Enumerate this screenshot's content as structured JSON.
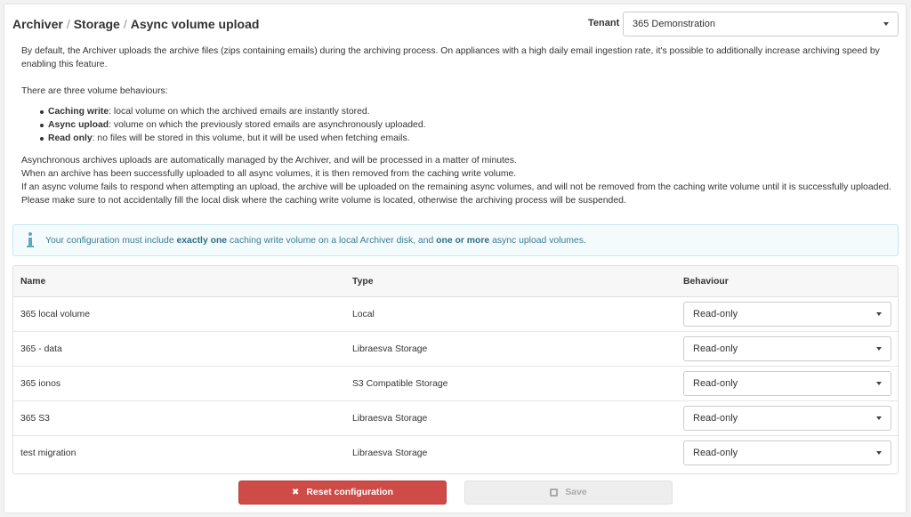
{
  "header": {
    "breadcrumb": [
      "Archiver",
      "Storage",
      "Async volume upload"
    ],
    "tenant_label": "Tenant",
    "tenant_value": "365 Demonstration"
  },
  "intro": {
    "p1": "By default, the Archiver uploads the archive files (zips containing emails) during the archiving process. On appliances with a high daily email ingestion rate, it's possible to additionally increase archiving speed by enabling this feature.",
    "p2": "There are three volume behaviours:",
    "bullets": [
      {
        "term": "Caching write",
        "desc": ": local volume on which the archived emails are instantly stored."
      },
      {
        "term": "Async upload",
        "desc": ": volume on which the previously stored emails are asynchronously uploaded."
      },
      {
        "term": "Read only",
        "desc": ": no files will be stored in this volume, but it will be used when fetching emails."
      }
    ],
    "lines": [
      "Asynchronous archives uploads are automatically managed by the Archiver, and will be processed in a matter of minutes.",
      "When an archive has been successfully uploaded to all async volumes, it is then removed from the caching write volume.",
      "If an async volume fails to respond when attempting an upload, the archive will be uploaded on the remaining async volumes, and will not be removed from the caching write volume until it is successfully uploaded.",
      "Please make sure to not accidentally fill the local disk where the caching write volume is located, otherwise the archiving process will be suspended."
    ]
  },
  "info": {
    "t1": "Your configuration must include ",
    "b1": "exactly one",
    "t2": " caching write volume on a local Archiver disk, and ",
    "b2": "one or more",
    "t3": " async upload volumes."
  },
  "table": {
    "headers": {
      "name": "Name",
      "type": "Type",
      "behaviour": "Behaviour"
    },
    "rows": [
      {
        "name": "365 local volume",
        "type": "Local",
        "behaviour": "Read-only"
      },
      {
        "name": "365 - data",
        "type": "Libraesva Storage",
        "behaviour": "Read-only"
      },
      {
        "name": "365 ionos",
        "type": "S3 Compatible Storage",
        "behaviour": "Read-only"
      },
      {
        "name": "365 S3",
        "type": "Libraesva Storage",
        "behaviour": "Read-only"
      },
      {
        "name": "test migration",
        "type": "Libraesva Storage",
        "behaviour": "Read-only"
      }
    ]
  },
  "buttons": {
    "reset_label": "Reset configuration",
    "save_label": "Save"
  },
  "colors": {
    "reset": "#cf4b47",
    "info_bg": "#f4fbfd",
    "info_text": "#3a7d96"
  }
}
